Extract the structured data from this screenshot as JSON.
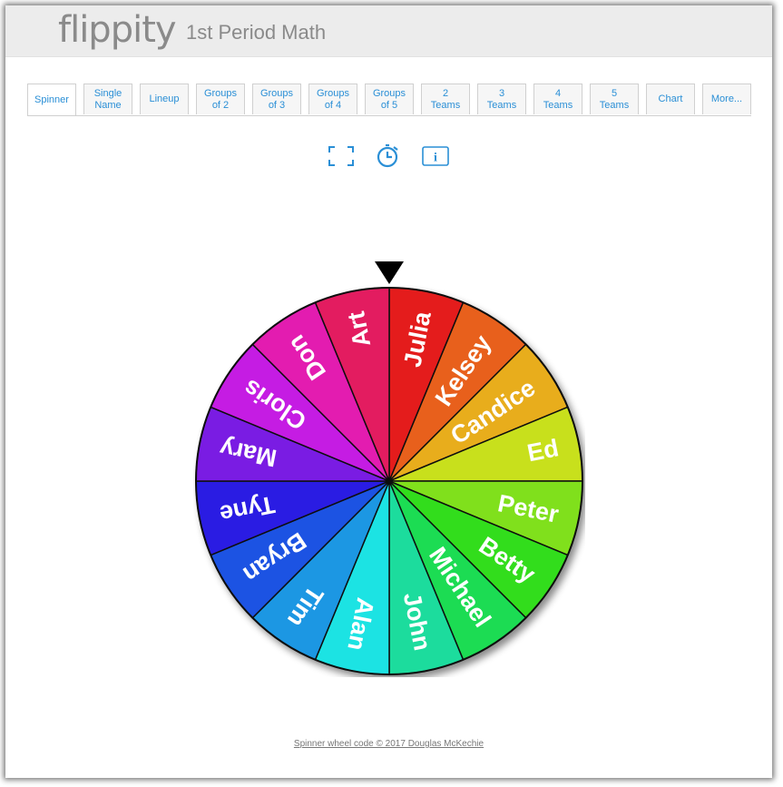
{
  "header": {
    "logo_text": "flippity",
    "title": "1st Period Math"
  },
  "tabs": [
    {
      "label": "Spinner",
      "active": true
    },
    {
      "label": "Single\nName"
    },
    {
      "label": "Lineup"
    },
    {
      "label": "Groups\nof 2"
    },
    {
      "label": "Groups\nof 3"
    },
    {
      "label": "Groups\nof 4"
    },
    {
      "label": "Groups\nof 5"
    },
    {
      "label": "2\nTeams"
    },
    {
      "label": "3\nTeams"
    },
    {
      "label": "4\nTeams"
    },
    {
      "label": "5\nTeams"
    },
    {
      "label": "Chart"
    },
    {
      "label": "More..."
    }
  ],
  "toolbar": {
    "icons": [
      "fullscreen-icon",
      "timer-icon",
      "info-icon"
    ],
    "accent_color": "#2a8fd6"
  },
  "wheel": {
    "names": [
      "Julia",
      "Kelsey",
      "Candice",
      "Ed",
      "Peter",
      "Betty",
      "Michael",
      "John",
      "Alan",
      "Tim",
      "Bryan",
      "Tyne",
      "Mary",
      "Cloris",
      "Don",
      "Art"
    ],
    "colors": [
      "#e41d1d",
      "#e8611b",
      "#e8ad1c",
      "#c8e01c",
      "#80e01c",
      "#33dd1b",
      "#1bdc52",
      "#1bdc9d",
      "#1be3e3",
      "#1b97e3",
      "#1b52e3",
      "#2a1be3",
      "#7a1be3",
      "#c51be3",
      "#e31bb0",
      "#e31b61"
    ]
  },
  "footer": {
    "credit": "Spinner wheel code © 2017 Douglas McKechie"
  }
}
